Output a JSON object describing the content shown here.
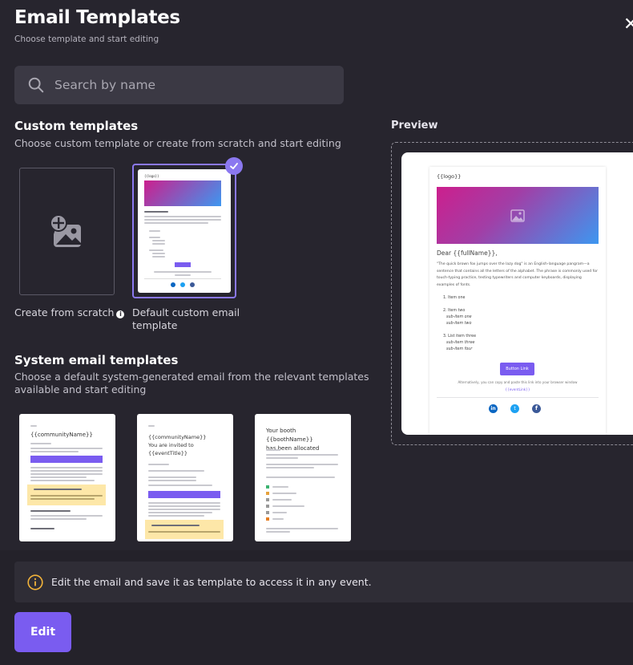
{
  "header": {
    "title": "Email Templates",
    "subtitle": "Choose template and start editing",
    "close_icon": "close-icon"
  },
  "search": {
    "placeholder": "Search by name",
    "value": ""
  },
  "custom": {
    "heading": "Custom templates",
    "description": "Choose custom template or create from scratch and start editing",
    "scratch_label": "Create from scratch",
    "default_label_line1": "Default custom email",
    "default_label_line2": "template"
  },
  "system": {
    "heading": "System email templates",
    "description_line1": "Choose a default system-generated email from the relevant templates",
    "description_line2": "available and start editing",
    "cards": [
      {
        "heading": "{{communityName}}"
      },
      {
        "heading_line1": "{{communityName}}",
        "heading_line2": "You are invited to",
        "heading_line3": "{{eventTitle}}"
      },
      {
        "heading_line1": "Your booth {{boothName}}",
        "heading_line2": "has been allocated"
      }
    ]
  },
  "preview": {
    "label": "Preview",
    "logo": "{{logo}}",
    "greeting": "Dear {{fullName}},",
    "body": "\"The quick brown fox jumps over the lazy dog\" is an English-language pangram—a sentence that contains all the letters of the alphabet. The phrase is commonly used for touch-typing practice, testing typewriters and computer keyboards, displaying examples of fonts.",
    "list": [
      {
        "item": "1. Item one",
        "subs": []
      },
      {
        "item": "2. Item two",
        "subs": [
          "sub-item one",
          "sub-item two"
        ]
      },
      {
        "item": "3. List item three",
        "subs": [
          "sub-item three",
          "sub-item four"
        ]
      }
    ],
    "button": "Button Link",
    "alt_text": "Alternatively, you can copy and paste this link into your browser window",
    "link": "{{eventLink}}",
    "socials": [
      "linkedin-icon",
      "twitter-icon",
      "facebook-icon"
    ]
  },
  "notice": {
    "text": "Edit the email and save it as template to access it in any event."
  },
  "actions": {
    "edit": "Edit"
  },
  "colors": {
    "background": "#27252e",
    "accent": "#7a5cf0",
    "warning": "#f2b33a",
    "banner_start": "#cc1f8d",
    "banner_end": "#3d97f0"
  }
}
